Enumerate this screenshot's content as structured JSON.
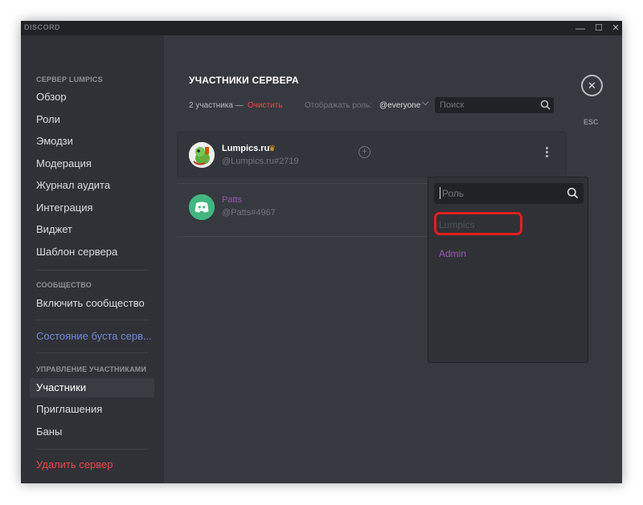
{
  "window": {
    "app_title": "DISCORD",
    "controls": {
      "minimize": "—",
      "maximize": "☐",
      "close": "✕"
    }
  },
  "sidebar": {
    "server_header": "СЕРВЕР LUMPICS",
    "server_items": [
      "Обзор",
      "Роли",
      "Эмодзи",
      "Модерация",
      "Журнал аудита",
      "Интеграция",
      "Виджет",
      "Шаблон сервера"
    ],
    "community_header": "СООБЩЕСТВО",
    "community_items": [
      "Включить сообщество"
    ],
    "boost_item": "Состояние буста серв...",
    "members_header": "УПРАВЛЕНИЕ УЧАСТНИКАМИ",
    "members_items": [
      "Участники",
      "Приглашения",
      "Баны"
    ],
    "active_item": "Участники",
    "delete_item": "Удалить сервер"
  },
  "main": {
    "title": "УЧАСТНИКИ СЕРВЕРА",
    "members_count": "2 участника —",
    "clear_label": "Очистить",
    "display_roles_label": "Отображать роль:",
    "role_filter_value": "@everyone",
    "search_placeholder": "Поиск",
    "close_label": "ESC",
    "members": [
      {
        "name": "Lumpics.ru",
        "tag": "@Lumpics.ru#2719",
        "owner": true,
        "name_color": "#ffffff"
      },
      {
        "name": "Patts",
        "tag": "@Patts#4967",
        "owner": false,
        "name_color": "#9b59b6"
      }
    ]
  },
  "role_popout": {
    "search_placeholder": "Роль",
    "roles": [
      {
        "name": "Lumpics",
        "color": "#4f545c",
        "highlighted": true
      },
      {
        "name": "Admin",
        "color": "#9b59b6",
        "highlighted": false
      }
    ]
  },
  "colors": {
    "accent_red": "#f04747",
    "link_blue": "#7289da",
    "highlight_red": "#e0201f",
    "owner_crown": "#faa61a",
    "discord_green": "#43b581"
  }
}
